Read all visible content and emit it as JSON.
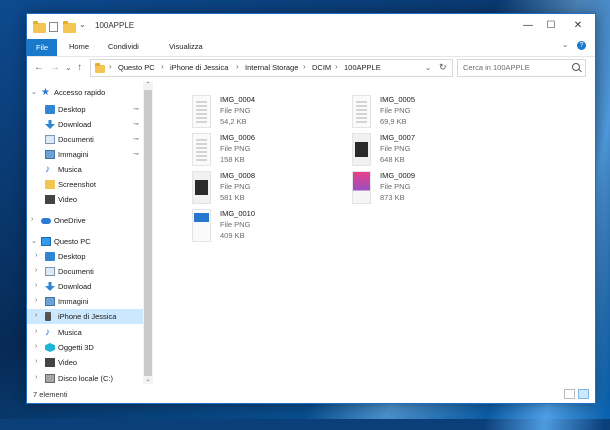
{
  "window": {
    "title": "100APPLE"
  },
  "titlebar": {
    "minimize": "—",
    "maximize": "☐",
    "close": "✕"
  },
  "ribbon": {
    "tabs": [
      "File",
      "Home",
      "Condividi",
      "Visualizza"
    ],
    "expand": "⌄",
    "help": "?"
  },
  "nav": {
    "back": "←",
    "forward": "→",
    "recent": "⌄",
    "up": "↑",
    "refresh": "↻",
    "addr_dropdown": "⌄"
  },
  "breadcrumb": [
    "Questo PC",
    "iPhone di Jessica",
    "Internal Storage",
    "DCIM",
    "100APPLE"
  ],
  "breadcrumb_sep": "›",
  "search": {
    "placeholder": "Cerca in 100APPLE"
  },
  "sidebar": {
    "items": [
      {
        "label": "Accesso rapido",
        "icon": "star-icon",
        "chev": "⌄",
        "pinned": false,
        "selected": false
      },
      {
        "label": "Desktop",
        "icon": "desktop-icon",
        "pinned": true,
        "selected": false
      },
      {
        "label": "Download",
        "icon": "download-icon",
        "pinned": true,
        "selected": false
      },
      {
        "label": "Documenti",
        "icon": "documents-icon",
        "pinned": true,
        "selected": false
      },
      {
        "label": "Immagini",
        "icon": "pictures-icon",
        "pinned": true,
        "selected": false
      },
      {
        "label": "Musica",
        "icon": "music-icon",
        "pinned": false,
        "selected": false
      },
      {
        "label": "Screenshot",
        "icon": "folder-icon",
        "pinned": false,
        "selected": false
      },
      {
        "label": "Video",
        "icon": "video-icon",
        "pinned": false,
        "selected": false
      },
      {
        "label": "OneDrive",
        "icon": "onedrive-icon",
        "chev": "›",
        "pinned": false,
        "selected": false
      },
      {
        "label": "Questo PC",
        "icon": "this-pc-icon",
        "chev": "⌄",
        "pinned": false,
        "selected": false
      },
      {
        "label": "Desktop",
        "icon": "desktop-icon",
        "chev": "›",
        "pinned": false,
        "selected": false
      },
      {
        "label": "Documenti",
        "icon": "documents-icon",
        "chev": "›",
        "pinned": false,
        "selected": false
      },
      {
        "label": "Download",
        "icon": "download-icon",
        "chev": "›",
        "pinned": false,
        "selected": false
      },
      {
        "label": "Immagini",
        "icon": "pictures-icon",
        "chev": "›",
        "pinned": false,
        "selected": false
      },
      {
        "label": "iPhone di Jessica",
        "icon": "iphone-icon",
        "chev": "›",
        "pinned": false,
        "selected": true
      },
      {
        "label": "Musica",
        "icon": "music-icon",
        "chev": "›",
        "pinned": false,
        "selected": false
      },
      {
        "label": "Oggetti 3D",
        "icon": "3d-objects-icon",
        "chev": "›",
        "pinned": false,
        "selected": false
      },
      {
        "label": "Video",
        "icon": "video-icon",
        "chev": "›",
        "pinned": false,
        "selected": false
      },
      {
        "label": "Disco locale (C:)",
        "icon": "local-disk-icon",
        "chev": "›",
        "pinned": false,
        "selected": false
      }
    ],
    "pin_glyph": "📌",
    "scroll_up": "⌃",
    "scroll_down": "⌄"
  },
  "files": [
    {
      "name": "IMG_0004",
      "type": "File PNG",
      "size": "54,2 KB",
      "thumb": "light"
    },
    {
      "name": "IMG_0005",
      "type": "File PNG",
      "size": "69,9 KB",
      "thumb": "light"
    },
    {
      "name": "IMG_0006",
      "type": "File PNG",
      "size": "158 KB",
      "thumb": "light"
    },
    {
      "name": "IMG_0007",
      "type": "File PNG",
      "size": "648 KB",
      "thumb": "dark"
    },
    {
      "name": "IMG_0008",
      "type": "File PNG",
      "size": "581 KB",
      "thumb": "dark"
    },
    {
      "name": "IMG_0009",
      "type": "File PNG",
      "size": "873 KB",
      "thumb": "pink"
    },
    {
      "name": "IMG_0010",
      "type": "File PNG",
      "size": "409 KB",
      "thumb": "blue"
    }
  ],
  "status": {
    "count": "7 elementi"
  }
}
